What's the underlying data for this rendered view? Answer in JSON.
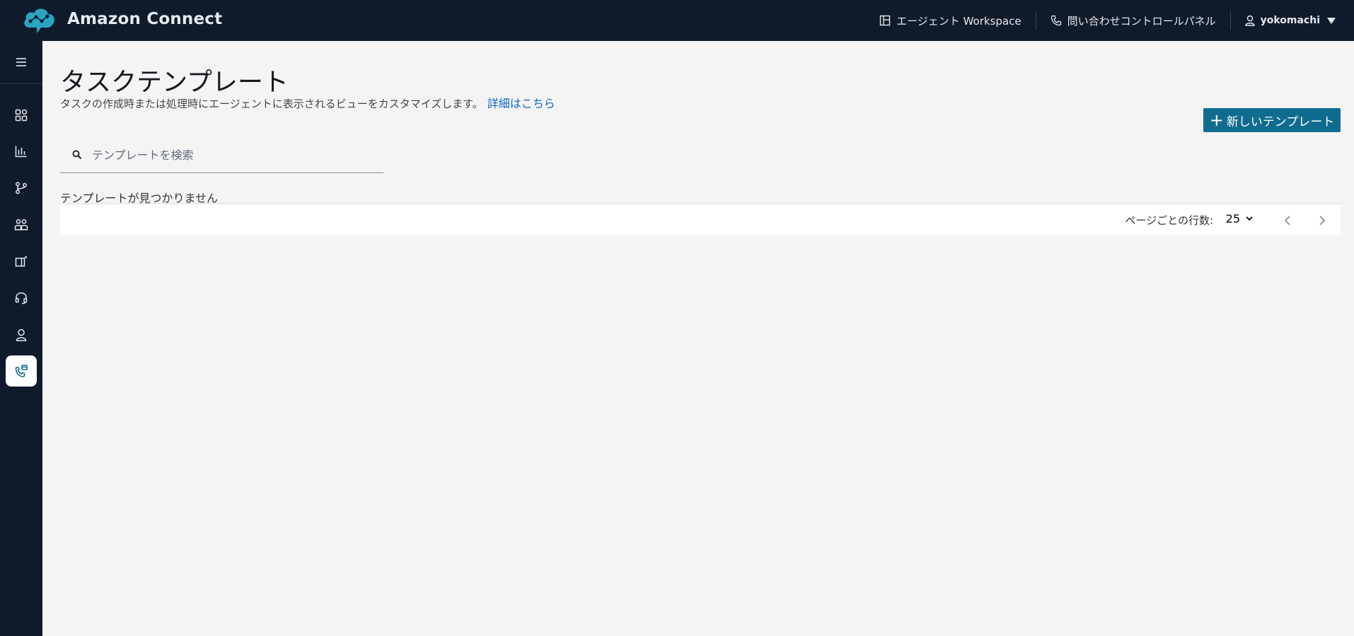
{
  "header": {
    "app_title": "Amazon Connect",
    "agent_workspace": "エージェント Workspace",
    "contact_control_panel": "問い合わせコントロールパネル",
    "user_name": "yokomachi"
  },
  "sidebar": {
    "items": [
      {
        "name": "menu-icon"
      },
      {
        "name": "dashboard-icon"
      },
      {
        "name": "analytics-icon"
      },
      {
        "name": "routing-icon"
      },
      {
        "name": "users-icon"
      },
      {
        "name": "channels-icon"
      },
      {
        "name": "headset-icon"
      },
      {
        "name": "profile-icon"
      },
      {
        "name": "task-templates-icon",
        "active": true
      }
    ]
  },
  "main": {
    "title": "タスクテンプレート",
    "description": "タスクの作成時または処理時にエージェントに表示されるビューをカスタマイズします。",
    "learn_more": "詳細はこちら",
    "new_button": "新しいテンプレート",
    "search_placeholder": "テンプレートを検索",
    "empty_message": "テンプレートが見つかりません",
    "rows_per_page_label": "ページごとの行数:",
    "rows_per_page_value": "25"
  },
  "colors": {
    "nav_bg": "#0f1b2a",
    "accent": "#0f6c8f",
    "link": "#0f68c5",
    "logo": "#29a5c1"
  }
}
